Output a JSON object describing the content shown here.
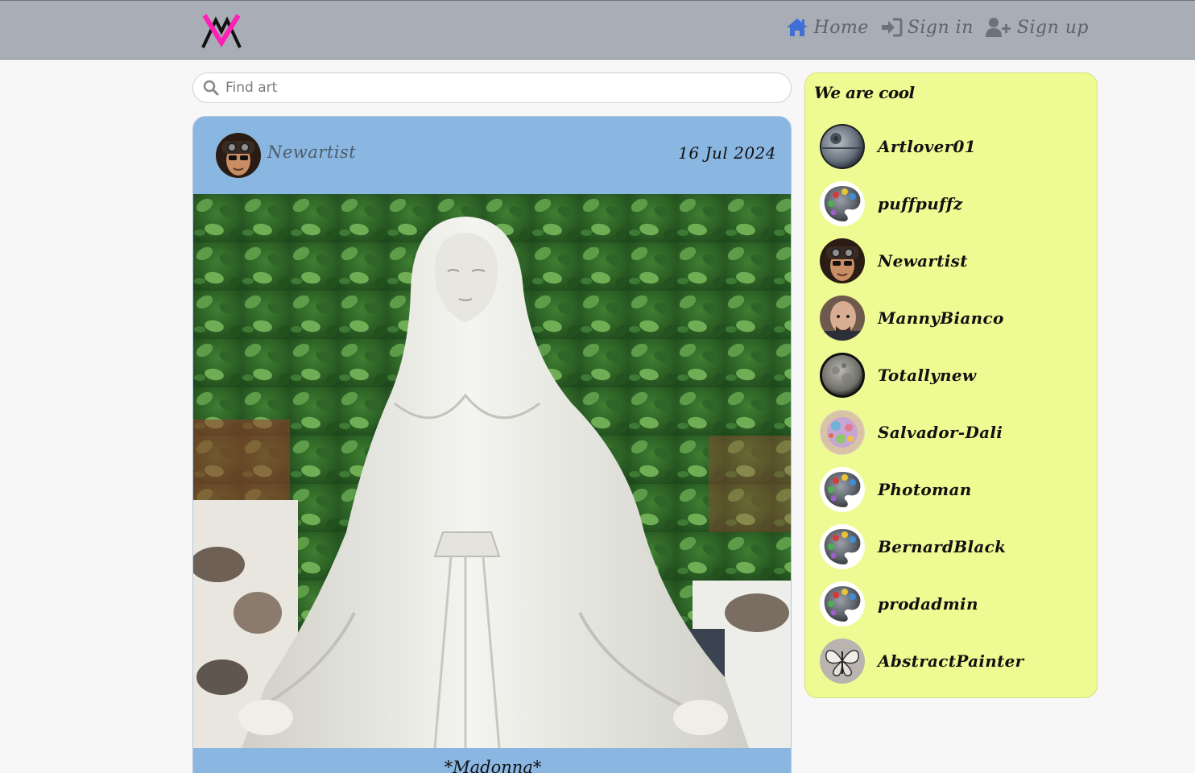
{
  "nav": {
    "logo_alt": "AV logo",
    "links": [
      {
        "label": "Home",
        "icon": "home-icon"
      },
      {
        "label": "Sign in",
        "icon": "sign-in-icon"
      },
      {
        "label": "Sign up",
        "icon": "user-plus-icon"
      }
    ]
  },
  "search": {
    "placeholder": "Find art",
    "value": ""
  },
  "post": {
    "author": "Newartist",
    "date": "16 Jul 2024",
    "title": "*Madonna*",
    "image": "madonna-statue-photo"
  },
  "sidebar": {
    "title": "We are cool",
    "artists": [
      {
        "name": "Artlover01",
        "avatar": "death-star"
      },
      {
        "name": "puffpuffz",
        "avatar": "palette"
      },
      {
        "name": "Newartist",
        "avatar": "goggles-man"
      },
      {
        "name": "MannyBianco",
        "avatar": "bald-man"
      },
      {
        "name": "Totallynew",
        "avatar": "moon"
      },
      {
        "name": "Salvador-Dali",
        "avatar": "colorful-swirl"
      },
      {
        "name": "Photoman",
        "avatar": "palette"
      },
      {
        "name": "BernardBlack",
        "avatar": "palette"
      },
      {
        "name": "prodadmin",
        "avatar": "palette"
      },
      {
        "name": "AbstractPainter",
        "avatar": "butterfly"
      }
    ]
  },
  "colors": {
    "navbar": "#a8adb6",
    "card": "#8ab7e2",
    "sidebar": "#eefa92",
    "logo_pink": "#ff1fb4"
  }
}
